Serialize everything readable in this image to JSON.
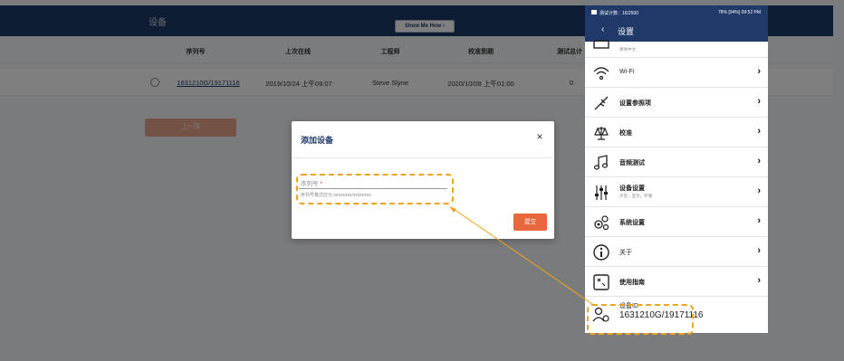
{
  "app": {
    "title": "设备",
    "show_me_how": "Show Me How ›",
    "columns": [
      "序列号",
      "上次在线",
      "工程师",
      "校准到期",
      "测试总计"
    ],
    "rows": [
      {
        "serial": "1631210G/19171116",
        "last_online": "2019/10/24 上午09:07",
        "engineer": "Steve Slyne",
        "calibration_due": "2020/10/08 上午01:00",
        "test_total": "0"
      }
    ],
    "prev_button": "上一页"
  },
  "modal": {
    "title": "添加设备",
    "close_icon": "×",
    "serial_placeholder": "序列号",
    "required_mark": "*",
    "serial_hint": "序列号格式应为 xxxxxxxx/xxxxxxxx",
    "submit_label": "提交"
  },
  "phone": {
    "status_left": "测试计数：16/2500",
    "status_right": "78% [94%] 09:52 PM",
    "back_icon": "‹",
    "title": "设置",
    "partial_item": "简体中文",
    "items": [
      {
        "label": "Wi-Fi",
        "icon": "wifi-icon"
      },
      {
        "label": "设置参照项",
        "icon": "probe-icon"
      },
      {
        "label": "校准",
        "icon": "scale-icon"
      },
      {
        "label": "音频测试",
        "icon": "music-icon"
      },
      {
        "label": "设备设置",
        "sub": "声音，显示，存储",
        "icon": "sliders-icon"
      },
      {
        "label": "系统设置",
        "icon": "gears-icon"
      },
      {
        "label": "关于",
        "icon": "info-icon"
      },
      {
        "label": "使用指南",
        "icon": "guide-icon"
      }
    ],
    "chevron": "›",
    "device_id_label": "设备ID",
    "device_id_value": "1631210G/19171116"
  },
  "colors": {
    "header": "#1f3a68",
    "highlight": "#f0a31f",
    "submit": "#e9673c"
  }
}
